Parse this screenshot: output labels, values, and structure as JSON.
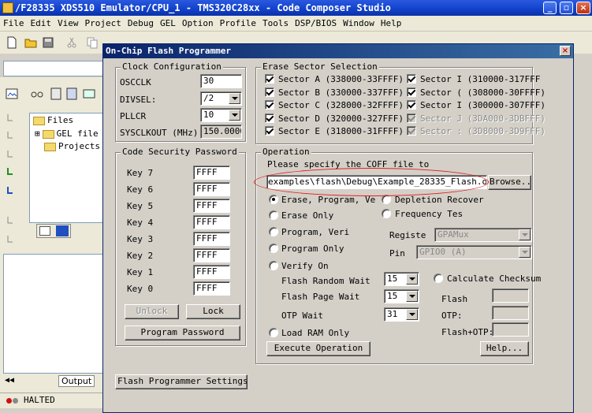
{
  "window": {
    "title": "/F28335 XDS510 Emulator/CPU_1 - TMS320C28xx - Code Composer Studio",
    "minimize": "_",
    "close": "×"
  },
  "menu": [
    "File",
    "Edit",
    "View",
    "Project",
    "Debug",
    "GEL",
    "Option",
    "Profile",
    "Tools",
    "DSP/BIOS",
    "Window",
    "Help"
  ],
  "project_tree": {
    "root": "Files",
    "items": [
      "GEL file",
      "Projects"
    ]
  },
  "output_tab": "Output",
  "status": "HALTED",
  "dialog": {
    "title": "On-Chip Flash Programmer",
    "close": "×",
    "clock": {
      "legend": "Clock Configuration",
      "osc_label": "OSCCLK",
      "osc_value": "30",
      "divsel_label": "DIVSEL:",
      "divsel_value": "/2",
      "pllcr_label": "PLLCR",
      "pllcr_value": "10",
      "sysclk_label": "SYSCLKOUT (MHz):",
      "sysclk_value": "150.0000"
    },
    "security": {
      "legend": "Code Security Password",
      "keys": [
        {
          "label": "Key 7",
          "value": "FFFF"
        },
        {
          "label": "Key 6",
          "value": "FFFF"
        },
        {
          "label": "Key 5",
          "value": "FFFF"
        },
        {
          "label": "Key 4",
          "value": "FFFF"
        },
        {
          "label": "Key 3",
          "value": "FFFF"
        },
        {
          "label": "Key 2",
          "value": "FFFF"
        },
        {
          "label": "Key 1",
          "value": "FFFF"
        },
        {
          "label": "Key 0",
          "value": "FFFF"
        }
      ],
      "unlock": "Unlock",
      "lock": "Lock",
      "program_password": "Program Password"
    },
    "erase": {
      "legend": "Erase Sector Selection",
      "left": [
        "Sector A (338000-33FFFF)",
        "Sector B (330000-337FFF)",
        "Sector C (328000-32FFFF)",
        "Sector D (320000-327FFF)",
        "Sector E (318000-31FFFF)"
      ],
      "right": [
        "Sector F (310000-317FFF",
        "Sector G (308000-30FFFF)",
        "Sector H (300000-307FFF)",
        "Sector I (3DA000-3DBFFF)",
        "Sector J (3D8000-3D9FFF)"
      ],
      "right_visible": [
        "Sector I (310000-317FFF",
        "Sector ( (308000-30FFFF)",
        "Sector I (300000-307FFF)",
        "Sector J (3DA000-3DBFFF)",
        "Sector : (3D8000-3D9FFF)"
      ]
    },
    "operation": {
      "legend": "Operation",
      "prompt": "Please specify the COFF file to",
      "coff_path": "examples\\flash\\Debug\\Example_28335_Flash.out",
      "browse": "Browse...",
      "opt_erase_prog_verify": "Erase, Program, Ve",
      "opt_erase_only": "Erase Only",
      "opt_program_verify": "Program, Veri",
      "opt_program_only": "Program Only",
      "opt_verify_only": "Verify On",
      "opt_depletion": "Depletion Recover",
      "opt_freq_test": "Frequency Tes",
      "register_label": "Registe",
      "register_value": "GPAMux",
      "pin_label": "Pin",
      "pin_value": "GPIO0 (A)",
      "random_wait_label": "Flash Random Wait",
      "random_wait_value": "15",
      "page_wait_label": "Flash Page Wait",
      "page_wait_value": "15",
      "otp_wait_label": "OTP Wait",
      "otp_wait_value": "31",
      "calc_checksum": "Calculate Checksum",
      "flash_label": "Flash",
      "otp_label": "OTP:",
      "flash_otp_label": "Flash+OTP:",
      "load_ram": "Load RAM Only",
      "execute": "Execute Operation",
      "help": "Help..."
    },
    "settings": "Flash Programmer Settings..."
  },
  "colors": {
    "titlebar": "#1141c9",
    "dialog_title": "#0a246a",
    "annotation": "#e02020"
  }
}
